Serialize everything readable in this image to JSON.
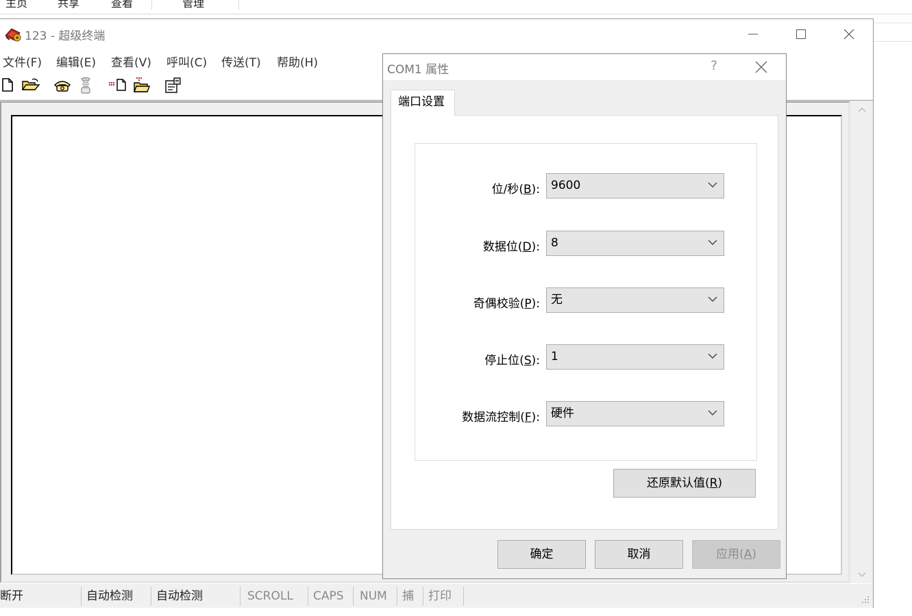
{
  "explorer": {
    "ribbon_tabs": [
      "主页",
      "共享",
      "查看",
      "管理"
    ]
  },
  "window": {
    "title": "123 - 超级终端",
    "icon": "hyperterminal-icon",
    "caption_buttons": [
      "minimize-icon",
      "maximize-icon",
      "close-icon"
    ]
  },
  "menubar": {
    "items": [
      "文件(F)",
      "编辑(E)",
      "查看(V)",
      "呼叫(C)",
      "传送(T)",
      "帮助(H)"
    ]
  },
  "toolbar": {
    "buttons": [
      "new-document-icon",
      "open-folder-icon",
      "call-phone-icon",
      "disconnect-phone-icon",
      "send-file-icon",
      "receive-file-icon",
      "properties-icon"
    ]
  },
  "statusbar": {
    "cells": [
      "断开",
      "自动检测",
      "自动检测",
      "SCROLL",
      "CAPS",
      "NUM",
      "捕",
      "打印"
    ]
  },
  "dialog": {
    "title": "COM1 属性",
    "help_glyph": "?",
    "tab": "端口设置",
    "fields": [
      {
        "label": "位/秒",
        "key": "B",
        "value": "9600"
      },
      {
        "label": "数据位",
        "key": "D",
        "value": "8"
      },
      {
        "label": "奇偶校验",
        "key": "P",
        "value": "无"
      },
      {
        "label": "停止位",
        "key": "S",
        "value": "1"
      },
      {
        "label": "数据流控制",
        "key": "F",
        "value": "硬件"
      }
    ],
    "restore_label": "还原默认值",
    "restore_key": "R",
    "ok_label": "确定",
    "cancel_label": "取消",
    "apply_label": "应用",
    "apply_key": "A"
  }
}
